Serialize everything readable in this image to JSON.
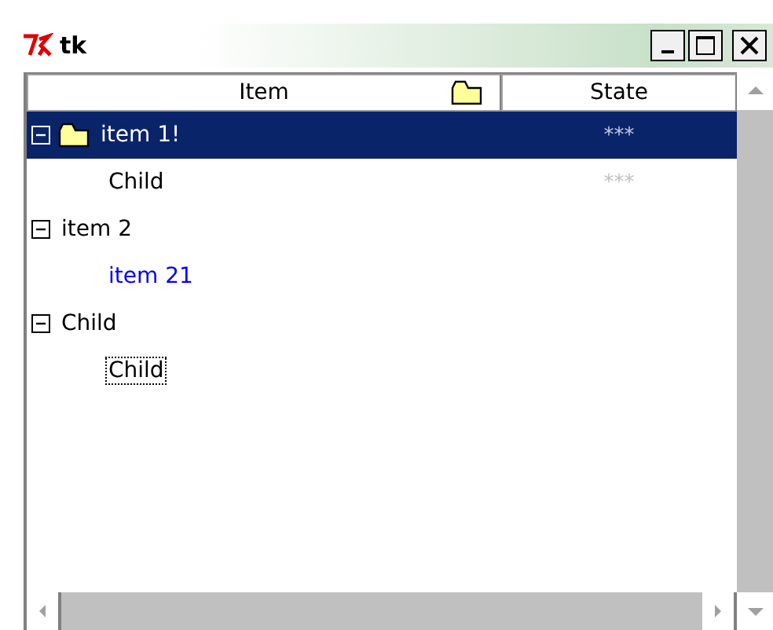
{
  "window": {
    "title": "tk"
  },
  "columns": [
    {
      "label": "Item",
      "icon": true
    },
    {
      "label": "State",
      "icon": false
    }
  ],
  "tree": [
    {
      "label": "item 1!",
      "state": "***",
      "icon": true,
      "expanded": true,
      "selected": true,
      "focused": false,
      "children": [
        {
          "label": "Child",
          "state": "***",
          "icon": false,
          "selected": false,
          "focused": false
        }
      ]
    },
    {
      "label": "item 2",
      "icon": false,
      "expanded": true,
      "selected": false,
      "focused": false,
      "children": [
        {
          "label": "item 21",
          "icon": false,
          "selected": false,
          "focused": false,
          "color": "#0000ff"
        }
      ]
    },
    {
      "label": "Child",
      "icon": false,
      "expanded": true,
      "selected": false,
      "focused": false,
      "children": [
        {
          "label": "Child",
          "icon": false,
          "selected": false,
          "focused": true
        }
      ]
    }
  ]
}
